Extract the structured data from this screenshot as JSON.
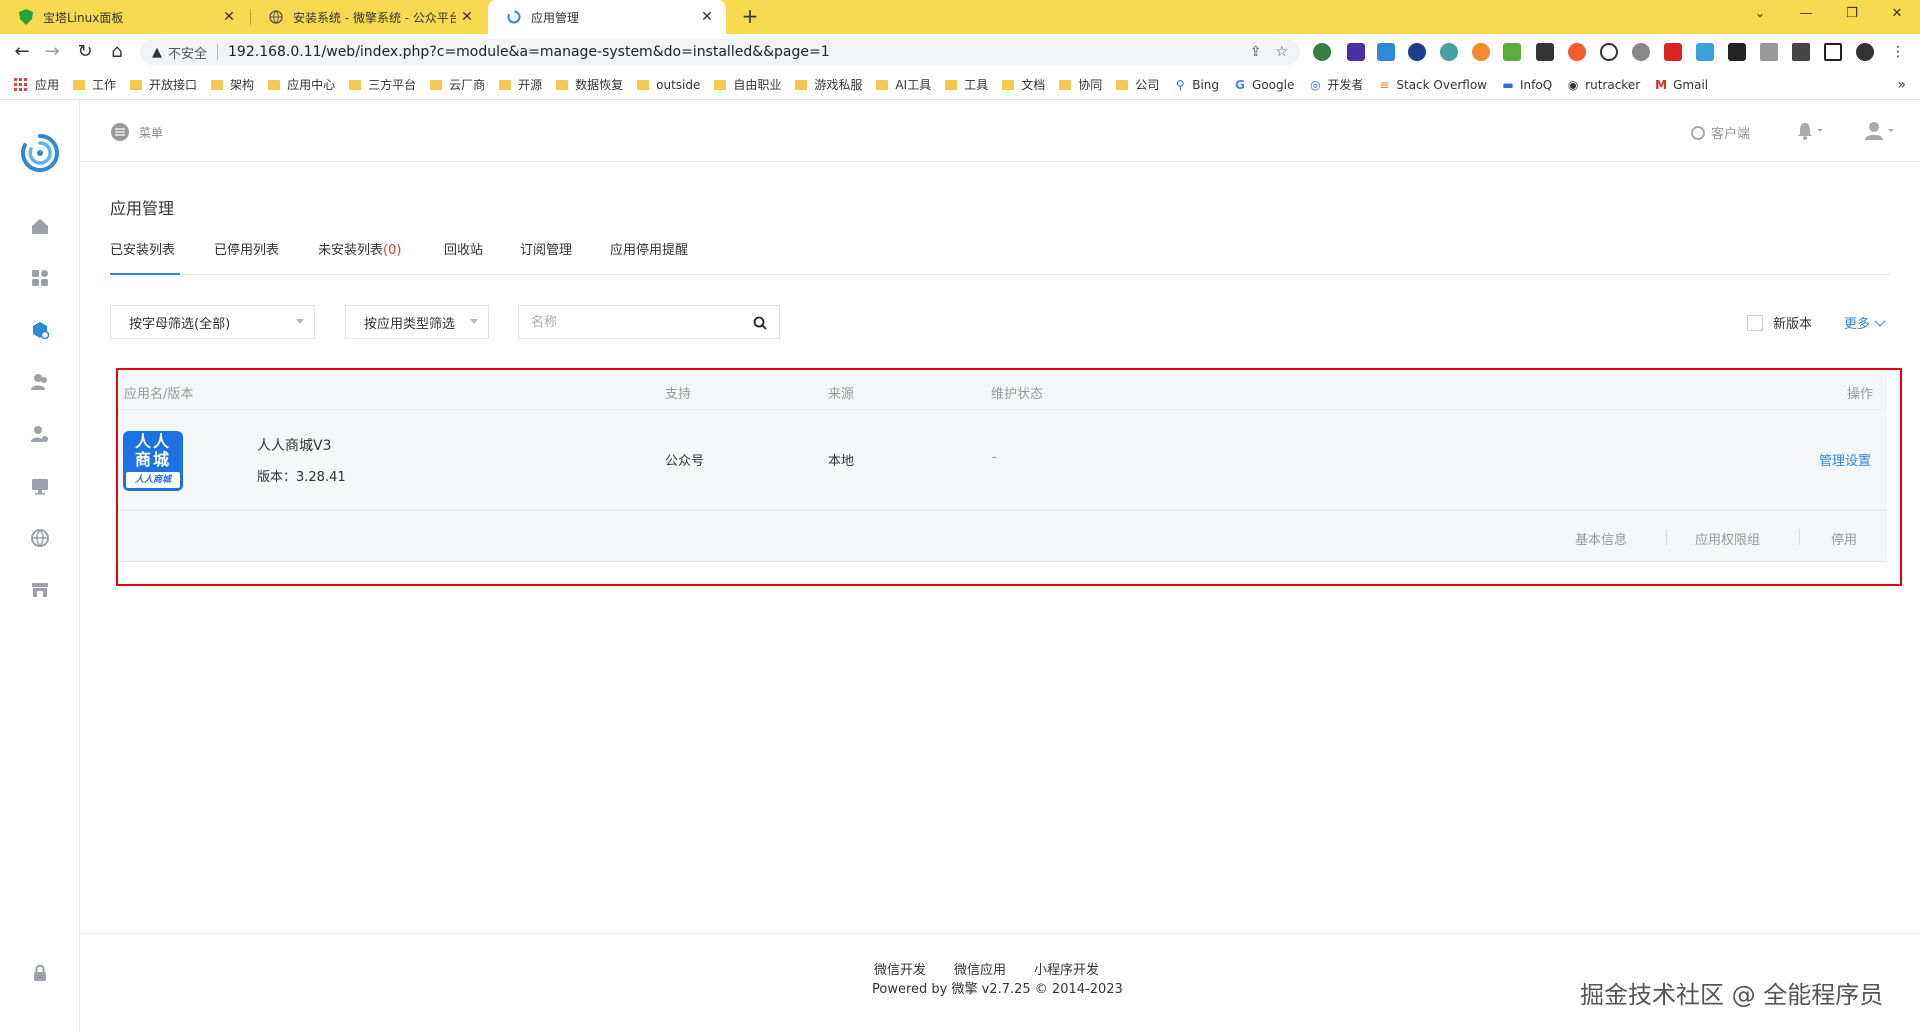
{
  "browser": {
    "tabs": [
      {
        "title": "宝塔Linux面板",
        "active": false
      },
      {
        "title": "安装系统 - 微擎系统 - 公众平台自",
        "active": false
      },
      {
        "title": "应用管理",
        "active": true
      }
    ],
    "insecure_label": "不安全",
    "url": "192.168.0.11/web/index.php?c=module&a=manage-system&do=installed&&page=1",
    "bookmarks": [
      "应用",
      "工作",
      "开放接口",
      "架构",
      "应用中心",
      "三方平台",
      "云厂商",
      "开源",
      "数据恢复",
      "outside",
      "自由职业",
      "游戏私服",
      "AI工具",
      "工具",
      "文档",
      "协同",
      "公司",
      "Bing",
      "Google",
      "开发者",
      "Stack Overflow",
      "InfoQ",
      "rutracker",
      "Gmail"
    ],
    "bookmark_more": "»"
  },
  "topbar": {
    "menu_label": "菜单",
    "client_label": "客户端"
  },
  "page": {
    "title": "应用管理",
    "tabs": [
      {
        "label": "已安装列表",
        "active": true
      },
      {
        "label": "已停用列表",
        "active": false
      },
      {
        "label": "未安装列表",
        "count": "(0)",
        "active": false
      },
      {
        "label": "回收站",
        "active": false
      },
      {
        "label": "订阅管理",
        "active": false
      },
      {
        "label": "应用停用提醒",
        "active": false
      }
    ],
    "filters": {
      "letter": "按字母筛选(全部)",
      "type": "按应用类型筛选",
      "search_placeholder": "名称",
      "new_version": "新版本",
      "more": "更多"
    }
  },
  "table": {
    "headers": {
      "name": "应用名/版本",
      "support": "支持",
      "source": "来源",
      "status": "维护状态",
      "action": "操作"
    },
    "rows": [
      {
        "icon_line1": "人人",
        "icon_line2": "商城",
        "icon_strip": "人人商城",
        "name": "人人商城V3",
        "version": "版本：3.28.41",
        "support": "公众号",
        "source": "本地",
        "status": "-",
        "manage": "管理设置",
        "actions": [
          "基本信息",
          "应用权限组",
          "停用"
        ]
      }
    ]
  },
  "footer": {
    "links": [
      "微信开发",
      "微信应用",
      "小程序开发"
    ],
    "powered": "Powered by 微擎 v2.7.25 © 2014-2023"
  },
  "watermark": "掘金技术社区 @ 全能程序员",
  "colors": {
    "accent": "#2f89d8",
    "highlight": "#e60012",
    "tabstrip": "#f8d94f",
    "badge_red": "#e4393c"
  }
}
